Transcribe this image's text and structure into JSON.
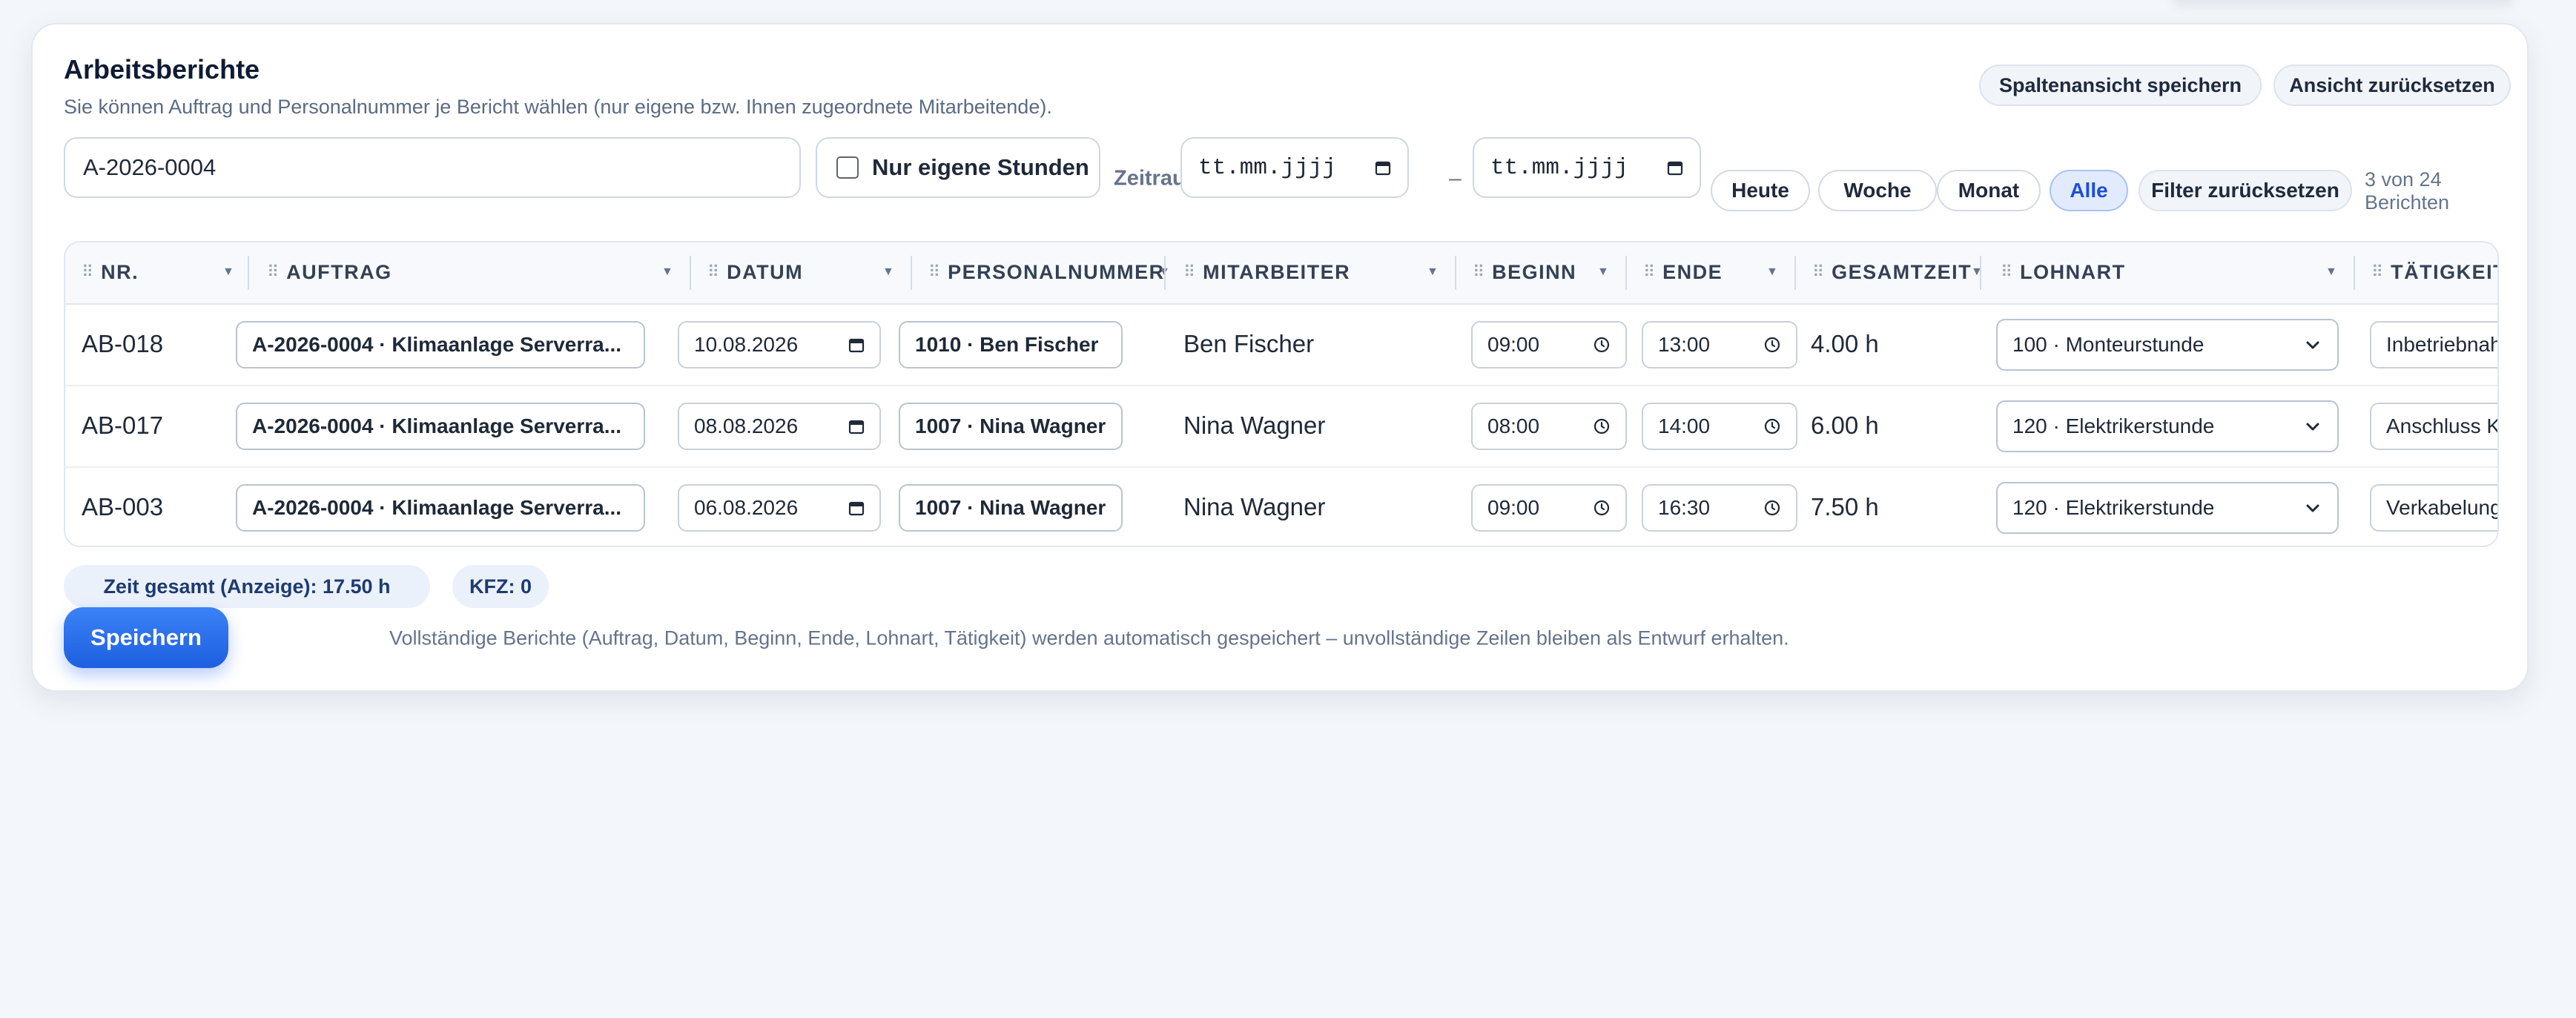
{
  "header": {
    "title": "Arbeitsberichte",
    "subtitle": "Sie können Auftrag und Personalnummer je Bericht wählen (nur eigene bzw. Ihnen zugeordnete Mitarbeitende).",
    "save_view_label": "Spaltenansicht speichern",
    "reset_view_label": "Ansicht zurücksetzen"
  },
  "filters": {
    "search_value": "A-2026-0004",
    "own_hours_label": "Nur eigene Stunden",
    "own_hours_checked": false,
    "period_label": "Zeitraum",
    "date_from_placeholder": "tt.mm.jjjj",
    "date_separator": "–",
    "date_to_placeholder": "tt.mm.jjjj",
    "quick": [
      "Heute",
      "Woche",
      "Monat",
      "Alle"
    ],
    "active_quick": "Alle",
    "reset_label": "Filter zurücksetzen",
    "result_count": "3 von 24 Berichten"
  },
  "table": {
    "columns": [
      "NR.",
      "AUFTRAG",
      "DATUM",
      "PERSONALNUMMER",
      "MITARBEITER",
      "BEGINN",
      "ENDE",
      "GESAMTZEIT",
      "LOHNART",
      "TÄTIGKEIT"
    ],
    "rows": [
      {
        "nr": "AB-018",
        "auftrag": "A-2026-0004 · Klimaanlage Serverra...",
        "datum": "10.08.2026",
        "personalnummer": "1010 · Ben Fischer",
        "mitarbeiter": "Ben Fischer",
        "beginn": "09:00",
        "ende": "13:00",
        "gesamtzeit": "4.00 h",
        "lohnart": "100 · Monteurstunde",
        "taetigkeit": "Inbetriebnahme"
      },
      {
        "nr": "AB-017",
        "auftrag": "A-2026-0004 · Klimaanlage Serverra...",
        "datum": "08.08.2026",
        "personalnummer": "1007 · Nina Wagner",
        "mitarbeiter": "Nina Wagner",
        "beginn": "08:00",
        "ende": "14:00",
        "gesamtzeit": "6.00 h",
        "lohnart": "120 · Elektrikerstunde",
        "taetigkeit": "Anschluss Kältev"
      },
      {
        "nr": "AB-003",
        "auftrag": "A-2026-0004 · Klimaanlage Serverra...",
        "datum": "06.08.2026",
        "personalnummer": "1007 · Nina Wagner",
        "mitarbeiter": "Nina Wagner",
        "beginn": "09:00",
        "ende": "16:30",
        "gesamtzeit": "7.50 h",
        "lohnart": "120 · Elektrikerstunde",
        "taetigkeit": "Verkabelung Klir"
      }
    ]
  },
  "footer": {
    "total_time": "Zeit gesamt (Anzeige): 17.50 h",
    "kfz": "KFZ: 0",
    "save_label": "Speichern",
    "hint": "Vollständige Berichte (Auftrag, Datum, Beginn, Ende, Lohnart, Tätigkeit) werden automatisch gespeichert – unvollständige Zeilen bleiben als Entwurf erhalten."
  },
  "colors": {
    "accent": "#2563eb",
    "active_chip_bg": "#e2ebfd",
    "page_bg": "#f3f6fa"
  }
}
